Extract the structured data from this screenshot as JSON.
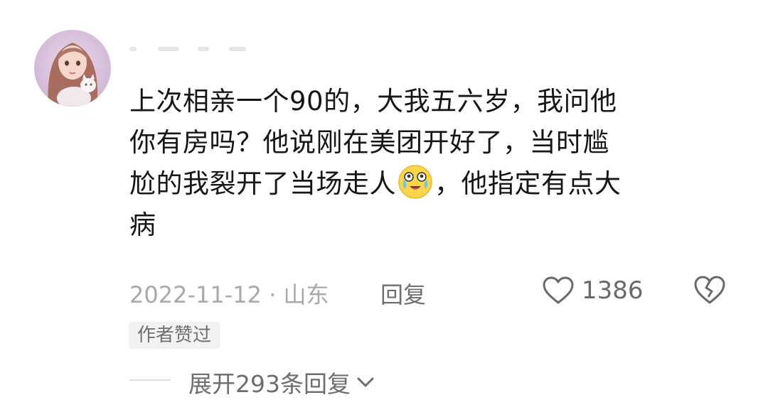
{
  "comment": {
    "text_lines": [
      "上次相亲一个90的，大我五六岁，我问他",
      "你有房吗？他说刚在美团开好了，当时尴",
      "尬的我裂开了当场走人",
      "，他指定有点大",
      "病"
    ],
    "emoji": "laughing-crying-emoji",
    "date_location": "2022-11-12 · 山东",
    "reply_label": "回复",
    "like_count": "1386",
    "author_badge": "作者赞过",
    "expand_label": "展开293条回复"
  },
  "colors": {
    "text": "#161616",
    "meta": "#a9a9a9",
    "action": "#6e6e6e",
    "badge_bg": "#f2f2f2"
  }
}
